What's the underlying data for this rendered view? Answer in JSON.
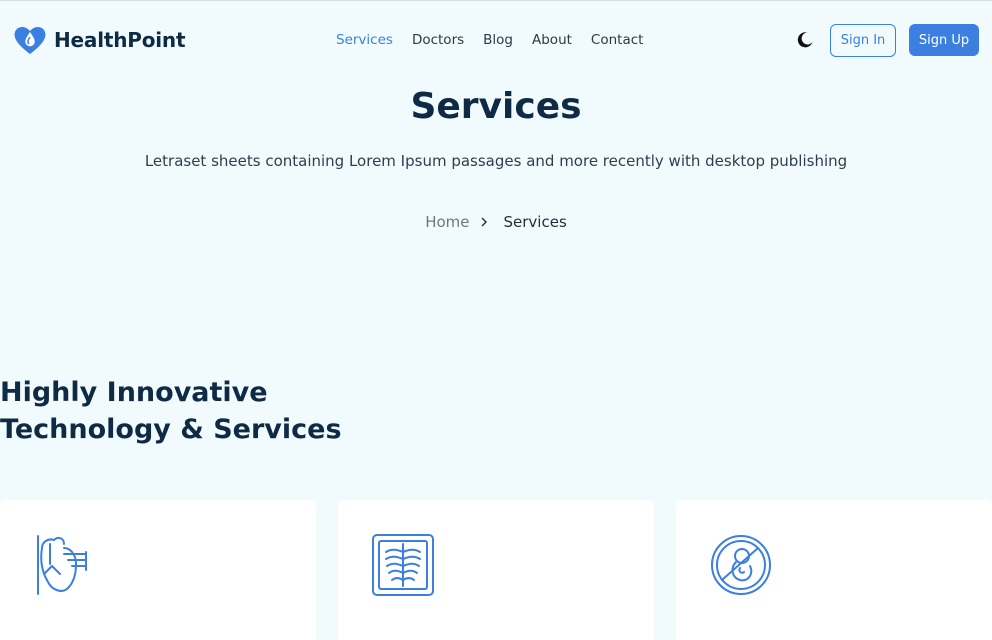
{
  "brand": {
    "name": "HealthPoint",
    "logo_icon": "heart-drop-icon",
    "accent": "#3b7fe0"
  },
  "nav": {
    "items": [
      {
        "label": "Services",
        "active": true
      },
      {
        "label": "Doctors",
        "active": false
      },
      {
        "label": "Blog",
        "active": false
      },
      {
        "label": "About",
        "active": false
      },
      {
        "label": "Contact",
        "active": false
      }
    ]
  },
  "header": {
    "theme_toggle_icon": "moon-icon",
    "signin_label": "Sign In",
    "signup_label": "Sign Up"
  },
  "hero": {
    "title": "Services",
    "subtitle": "Letraset sheets containing Lorem Ipsum passages and more recently with desktop publishing",
    "breadcrumb": {
      "home": "Home",
      "current": "Services"
    }
  },
  "section": {
    "title_line1": "Highly Innovative",
    "title_line2": "Technology & Services"
  },
  "cards": [
    {
      "icon": "heart-organ-icon"
    },
    {
      "icon": "xray-icon"
    },
    {
      "icon": "pregnancy-icon"
    }
  ]
}
